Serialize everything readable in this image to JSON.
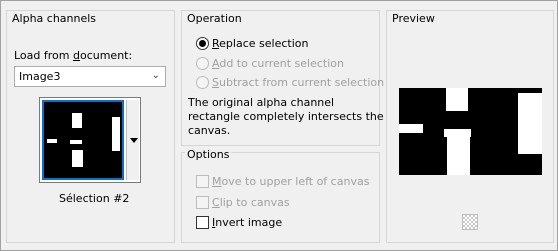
{
  "alpha": {
    "group_title": "Alpha channels",
    "load_label_prefix": "Load from ",
    "load_label_underlined": "d",
    "load_label_suffix": "ocument:",
    "select_value": "Image3",
    "selection_name": "Sélection #2"
  },
  "operation": {
    "group_title": "Operation",
    "options": [
      {
        "label_u": "R",
        "label_rest": "eplace selection",
        "selected": true,
        "enabled": true
      },
      {
        "label_u": "A",
        "label_rest": "dd to current selection",
        "selected": false,
        "enabled": false
      },
      {
        "label_u": "S",
        "label_rest": "ubtract from current selection",
        "selected": false,
        "enabled": false
      }
    ],
    "message_line1": "The original alpha channel",
    "message_line2": "rectangle completely intersects the",
    "message_line3": "canvas."
  },
  "options": {
    "group_title": "Options",
    "items": [
      {
        "label_u": "M",
        "label_rest": "ove to upper left of canvas",
        "checked": false,
        "enabled": false
      },
      {
        "label_u": "C",
        "label_rest": "lip to canvas",
        "checked": false,
        "enabled": false
      },
      {
        "label_u": "I",
        "label_rest": "nvert image",
        "checked": false,
        "enabled": true
      }
    ]
  },
  "preview": {
    "group_title": "Preview",
    "pattern_icon": "checkerboard-icon"
  },
  "colors": {
    "accent": "#0a70d0",
    "background": "#f0f0f0",
    "disabled_text": "#a0a0a0"
  }
}
